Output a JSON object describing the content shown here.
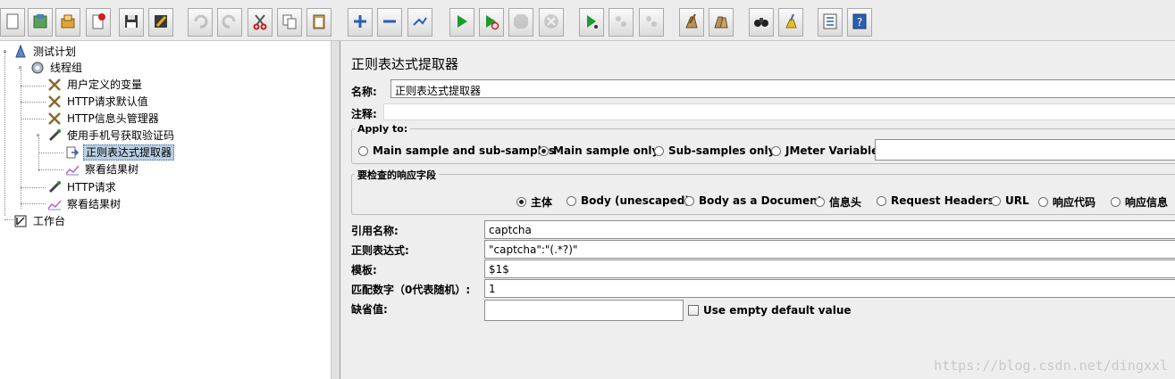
{
  "toolbar": {
    "buttons": [
      {
        "name": "new-icon"
      },
      {
        "name": "templates-icon"
      },
      {
        "name": "open-icon"
      },
      {
        "name": "close-icon"
      },
      {
        "name": "save-icon"
      },
      {
        "name": "save-as-icon"
      },
      {
        "name": "undo-icon"
      },
      {
        "name": "redo-icon"
      },
      {
        "name": "cut-icon"
      },
      {
        "name": "copy-icon"
      },
      {
        "name": "paste-icon"
      },
      {
        "name": "expand-icon"
      },
      {
        "name": "collapse-icon"
      },
      {
        "name": "toggle-icon"
      },
      {
        "name": "start-icon"
      },
      {
        "name": "start-no-pause-icon"
      },
      {
        "name": "stop-icon"
      },
      {
        "name": "shutdown-icon"
      },
      {
        "name": "remote-start-icon"
      },
      {
        "name": "remote-stop-icon"
      },
      {
        "name": "remote-exit-icon"
      },
      {
        "name": "clear-icon"
      },
      {
        "name": "clear-all-icon"
      },
      {
        "name": "search-icon"
      },
      {
        "name": "reset-search-icon"
      },
      {
        "name": "function-helper-icon"
      },
      {
        "name": "help-icon"
      }
    ]
  },
  "tree": {
    "items": [
      {
        "label": "测试计划",
        "icon": "test-plan-icon"
      },
      {
        "label": "线程组",
        "icon": "thread-group-icon"
      },
      {
        "label": "用户定义的变量",
        "icon": "config-icon"
      },
      {
        "label": "HTTP请求默认值",
        "icon": "config-icon"
      },
      {
        "label": "HTTP信息头管理器",
        "icon": "config-icon"
      },
      {
        "label": "使用手机号获取验证码",
        "icon": "sampler-icon"
      },
      {
        "label": "正则表达式提取器",
        "icon": "extractor-icon"
      },
      {
        "label": "察看结果树",
        "icon": "listener-icon"
      },
      {
        "label": "HTTP请求",
        "icon": "sampler-icon"
      },
      {
        "label": "察看结果树",
        "icon": "listener-icon"
      },
      {
        "label": "工作台",
        "icon": "workbench-icon"
      }
    ]
  },
  "panel": {
    "title": "正则表达式提取器",
    "name_label": "名称:",
    "name_value": "正则表达式提取器",
    "comment_label": "注释:",
    "apply_to": {
      "legend": "Apply to:",
      "options": [
        "Main sample and sub-samples",
        "Main sample only",
        "Sub-samples only",
        "JMeter Variable"
      ],
      "selected": 1
    },
    "response_field": {
      "legend": "要检查的响应字段",
      "options": [
        "主体",
        "Body (unescaped)",
        "Body as a Document",
        "信息头",
        "Request Headers",
        "URL",
        "响应代码",
        "响应信息"
      ],
      "selected": 0
    },
    "ref_name_label": "引用名称:",
    "ref_name_value": "captcha",
    "regex_label": "正则表达式:",
    "regex_value": "\"captcha\":\"(.*?)\"",
    "template_label": "模板:",
    "template_value": "$1$",
    "match_no_label": "匹配数字（0代表随机）:",
    "match_no_value": "1",
    "default_label": "缺省值:",
    "default_value": "",
    "use_empty_default_label": "Use empty default value"
  },
  "watermark": "https://blog.csdn.net/dingxxl"
}
